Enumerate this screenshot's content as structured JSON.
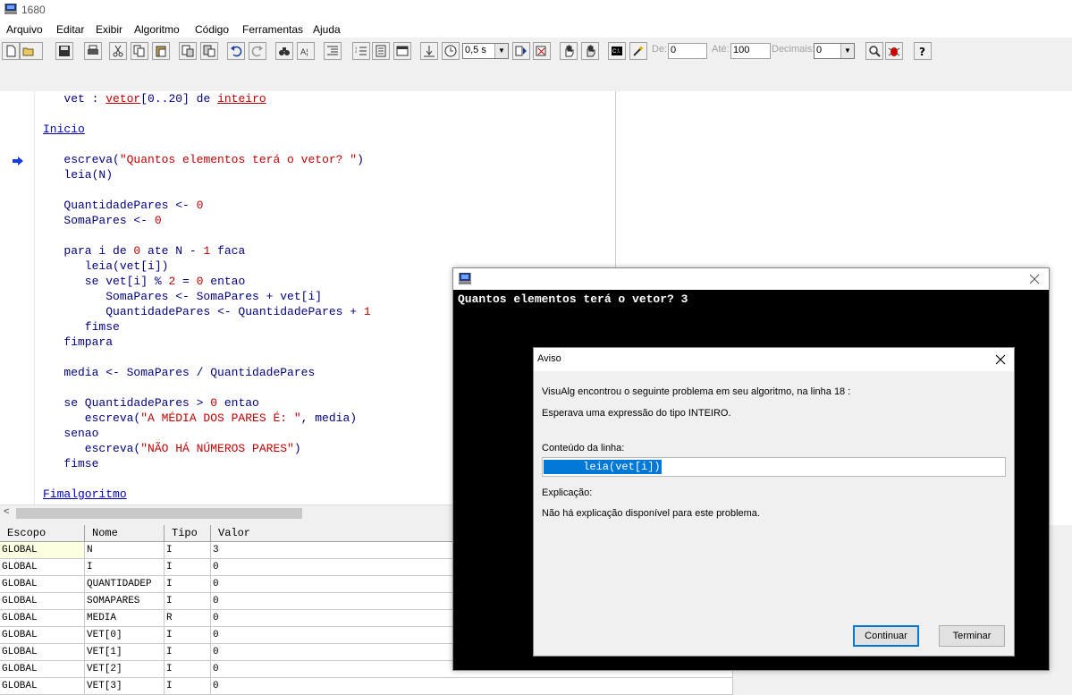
{
  "window": {
    "title": "1680"
  },
  "menu": [
    "Arquivo",
    "Editar",
    "Exibir",
    "Algoritmo",
    "Código",
    "Ferramentas",
    "Ajuda"
  ],
  "toolbar": {
    "speed_value": "0,5 s",
    "de_label": "De:",
    "de_value": "0",
    "ate_label": "Até:",
    "ate_value": "100",
    "decimais_label": "Decimais:",
    "decimais_value": "0"
  },
  "editor": {
    "lines": [
      {
        "id": "l1",
        "parts": [
          [
            "",
            "   vet : "
          ],
          [
            "type-ul",
            "vetor"
          ],
          [
            "",
            "[0..20] de "
          ],
          [
            "type-ul",
            "inteiro"
          ]
        ]
      },
      {
        "id": "l2",
        "parts": [
          [
            "kw-ul",
            "Inicio"
          ]
        ]
      },
      {
        "id": "l3",
        "parts": [
          [
            "",
            "   escreva("
          ],
          [
            "str",
            "\"Quantos elementos terá o vetor? \""
          ],
          [
            "",
            ")"
          ]
        ]
      },
      {
        "id": "l4",
        "parts": [
          [
            "",
            "   leia(N)"
          ]
        ]
      },
      {
        "id": "l5",
        "parts": [
          [
            "",
            "   QuantidadePares <- "
          ],
          [
            "num",
            "0"
          ]
        ]
      },
      {
        "id": "l6",
        "parts": [
          [
            "",
            "   SomaPares <- "
          ],
          [
            "num",
            "0"
          ]
        ]
      },
      {
        "id": "l7",
        "parts": [
          [
            "",
            "   para i de "
          ],
          [
            "num",
            "0"
          ],
          [
            "",
            " ate N - "
          ],
          [
            "num",
            "1"
          ],
          [
            "",
            " faca"
          ]
        ]
      },
      {
        "id": "l8",
        "parts": [
          [
            "",
            "      leia(vet[i])"
          ]
        ]
      },
      {
        "id": "l9",
        "parts": [
          [
            "",
            "      se vet[i] % "
          ],
          [
            "num",
            "2"
          ],
          [
            "",
            " = "
          ],
          [
            "num",
            "0"
          ],
          [
            "",
            " entao"
          ]
        ]
      },
      {
        "id": "l10",
        "parts": [
          [
            "",
            "         SomaPares <- SomaPares + vet[i]"
          ]
        ]
      },
      {
        "id": "l11",
        "parts": [
          [
            "",
            "         QuantidadePares <- QuantidadePares + "
          ],
          [
            "num",
            "1"
          ]
        ]
      },
      {
        "id": "l12",
        "parts": [
          [
            "",
            "      fimse"
          ]
        ]
      },
      {
        "id": "l13",
        "parts": [
          [
            "",
            "   fimpara"
          ]
        ]
      },
      {
        "id": "l14",
        "parts": [
          [
            "",
            "   media <- SomaPares / QuantidadePares"
          ]
        ]
      },
      {
        "id": "l15",
        "parts": [
          [
            "",
            "   se QuantidadePares > "
          ],
          [
            "num",
            "0"
          ],
          [
            "",
            " entao"
          ]
        ]
      },
      {
        "id": "l16",
        "parts": [
          [
            "",
            "      escreva("
          ],
          [
            "str",
            "\"A MÉDIA DOS PARES É: \""
          ],
          [
            "",
            ", media)"
          ]
        ]
      },
      {
        "id": "l17",
        "parts": [
          [
            "",
            "   senao"
          ]
        ]
      },
      {
        "id": "l18",
        "parts": [
          [
            "",
            "      escreva("
          ],
          [
            "str",
            "\"NÃO HÁ NÚMEROS PARES\""
          ],
          [
            "",
            ")"
          ]
        ]
      },
      {
        "id": "l19",
        "parts": [
          [
            "",
            "   fimse"
          ]
        ]
      },
      {
        "id": "l20",
        "parts": [
          [
            "kw-ul",
            "Fimalgoritmo"
          ]
        ]
      }
    ]
  },
  "vartable": {
    "headers": [
      "Escopo",
      "Nome",
      "Tipo",
      "Valor"
    ],
    "rows": [
      [
        "GLOBAL",
        "N",
        "I",
        "3"
      ],
      [
        "GLOBAL",
        "I",
        "I",
        "0"
      ],
      [
        "GLOBAL",
        "QUANTIDADEP",
        "I",
        "0"
      ],
      [
        "GLOBAL",
        "SOMAPARES",
        "I",
        "0"
      ],
      [
        "GLOBAL",
        "MEDIA",
        "R",
        "0"
      ],
      [
        "GLOBAL",
        "VET[0]",
        "I",
        "0"
      ],
      [
        "GLOBAL",
        "VET[1]",
        "I",
        "0"
      ],
      [
        "GLOBAL",
        "VET[2]",
        "I",
        "0"
      ],
      [
        "GLOBAL",
        "VET[3]",
        "I",
        "0"
      ]
    ]
  },
  "console": {
    "output": "Quantos elementos terá o vetor? 3"
  },
  "dialog": {
    "title": "Aviso",
    "message": "VisuAlg encontrou o seguinte problema em seu algoritmo, na linha 18 :",
    "error": "Esperava uma expressão do tipo INTEIRO.",
    "line_label": "Conteúdo da linha:",
    "line_content": "      leia(vet[i])",
    "explain_label": "Explicação:",
    "explain_text": "Não há explicação disponível para este problema.",
    "continue_label": "Continuar",
    "terminate_label": "Terminar"
  },
  "colors": {
    "code": "#000080",
    "string": "#c00000",
    "keyword": "#0000c0",
    "selection": "#0078d7"
  }
}
